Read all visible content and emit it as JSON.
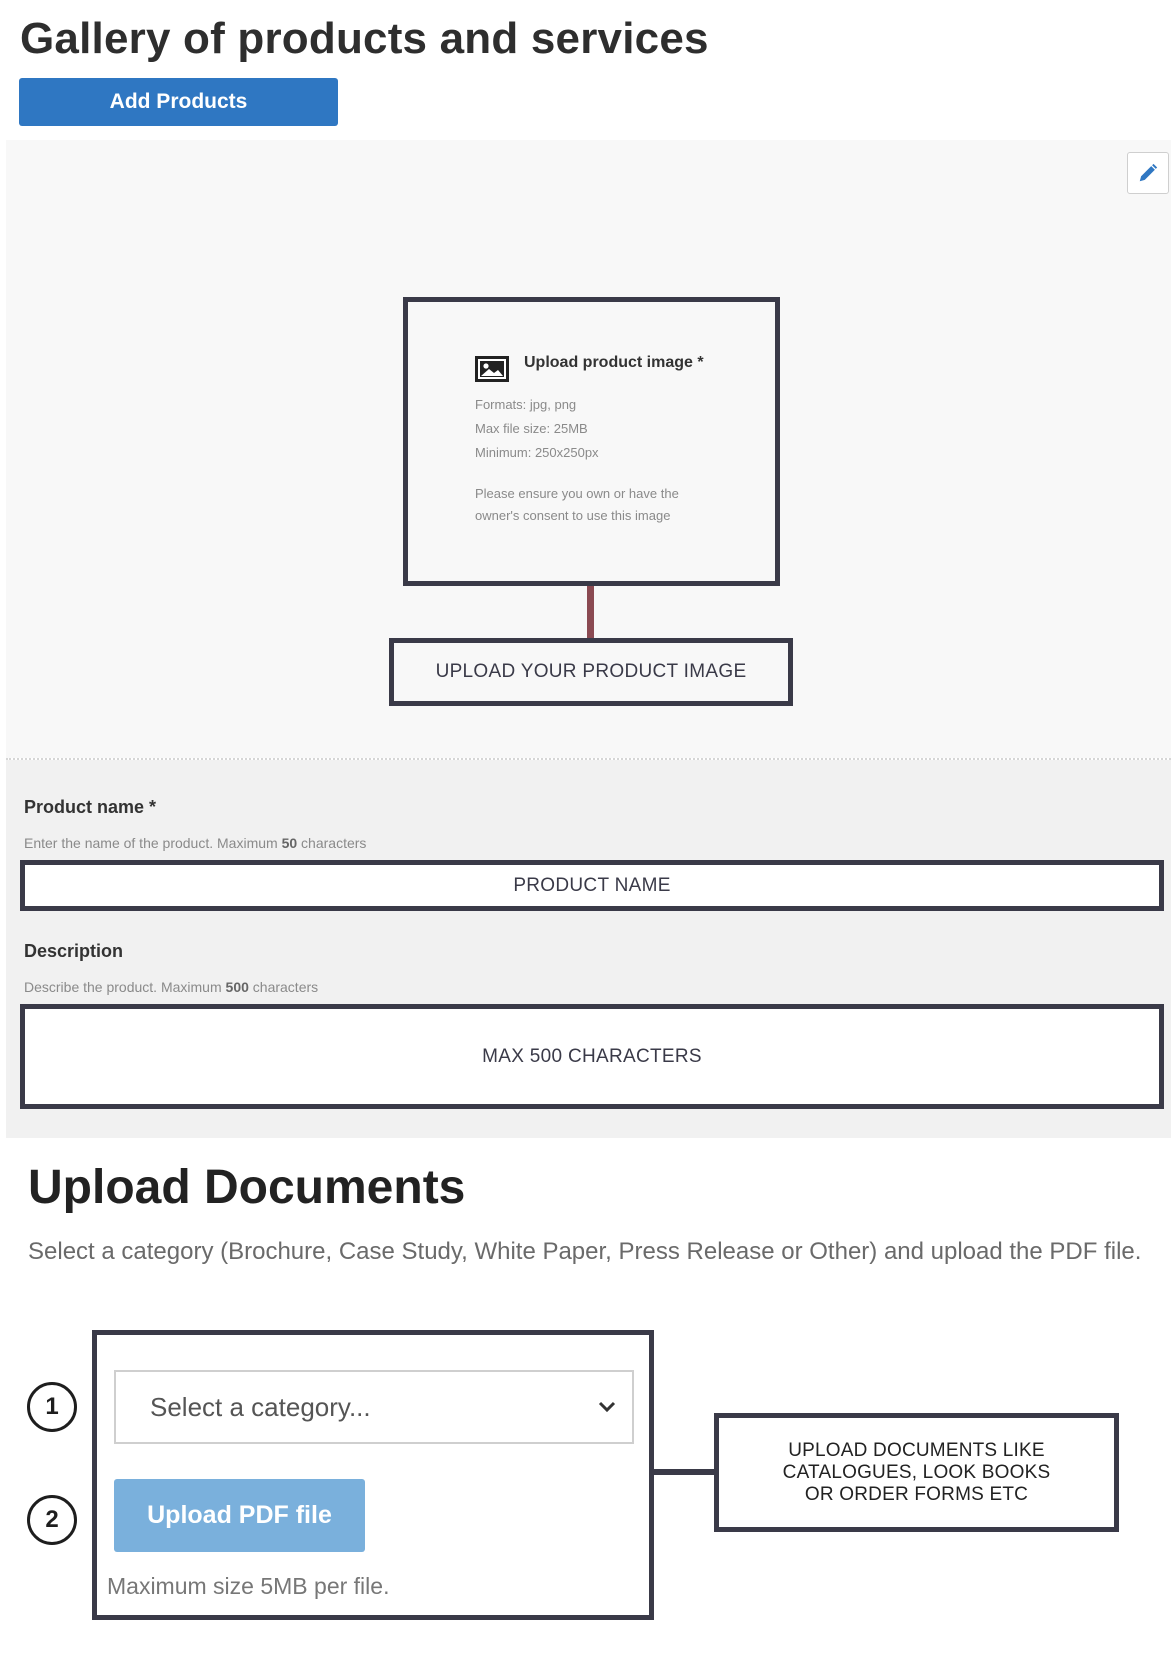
{
  "gallery": {
    "title": "Gallery of products and services",
    "add_button_label": "Add Products"
  },
  "image_upload": {
    "title": "Upload product image *",
    "formats": "Formats: jpg, png",
    "max_size": "Max file size: 25MB",
    "minimum": "Minimum: 250x250px",
    "consent_line1": "Please ensure you own or have the",
    "consent_line2": "owner's consent to use this image",
    "callout": "UPLOAD YOUR PRODUCT IMAGE"
  },
  "product_name": {
    "label": "Product name *",
    "help_prefix": "Enter the name of the product. Maximum",
    "help_max": "50",
    "help_suffix": "characters",
    "field_text": "PRODUCT NAME"
  },
  "description": {
    "label": "Description",
    "help_prefix": "Describe the product. Maximum",
    "help_max": "500",
    "help_suffix": "characters",
    "field_text": "MAX 500 CHARACTERS"
  },
  "documents": {
    "title": "Upload Documents",
    "description": "Select a category (Brochure, Case Study, White Paper, Press Release or Other) and upload the PDF file.",
    "step1": "1",
    "step2": "2",
    "category_placeholder": "Select a category...",
    "upload_button": "Upload PDF file",
    "max_size_note": "Maximum size 5MB per file.",
    "callout_line1": "UPLOAD DOCUMENTS LIKE",
    "callout_line2": "CATALOGUES, LOOK BOOKS",
    "callout_line3": "OR ORDER FORMS ETC"
  },
  "icons": {
    "edit": "pencil-icon",
    "image": "image-icon",
    "dropdown": "chevron-down-icon"
  },
  "colors": {
    "primary_button": "#2f77c2",
    "disabled_button": "#7ab0dc",
    "annotation_border": "#3a3a48",
    "connector": "#8b4a52"
  }
}
